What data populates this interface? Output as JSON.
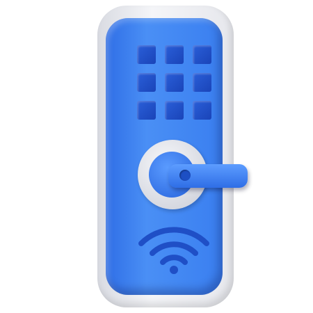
{
  "icon": "smart-door-lock",
  "colors": {
    "panel": "#3a7ff0",
    "keys": "#1f4fc6",
    "plate": "#e6e7ec",
    "ring": "#dfe1e8"
  },
  "keypad": {
    "rows": 3,
    "columns": 3
  }
}
